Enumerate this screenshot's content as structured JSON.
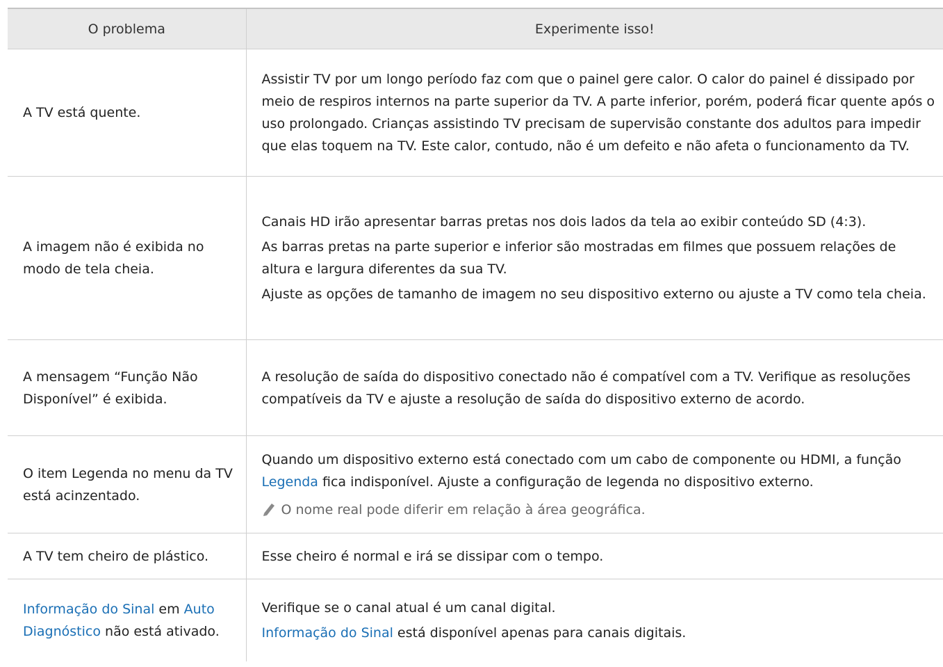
{
  "header": {
    "problem": "O problema",
    "solution": "Experimente isso!"
  },
  "rows": [
    {
      "problem": "A TV está quente.",
      "solution": [
        "Assistir TV por um longo período faz com que o painel gere calor. O calor do painel é dissipado por meio de respiros internos na parte superior da TV. A parte inferior, porém, poderá ficar quente após o uso prolongado. Crianças assistindo TV precisam de supervisão constante dos adultos para impedir que elas toquem na TV. Este calor, contudo, não é um defeito e não afeta o funcionamento da TV."
      ]
    },
    {
      "problem": "A imagem não é exibida no modo de tela cheia.",
      "solution": [
        "Canais HD irão apresentar barras pretas nos dois lados da tela ao exibir conteúdo SD (4:3).",
        "As barras pretas na parte superior e inferior são mostradas em filmes que possuem relações de altura e largura diferentes da sua TV.",
        "Ajuste as opções de tamanho de imagem no seu dispositivo externo ou ajuste a TV como tela cheia."
      ]
    },
    {
      "problem": "A mensagem “Função Não Disponível” é exibida.",
      "solution": [
        "A resolução de saída do dispositivo conectado não é compatível com a TV. Verifique as resoluções compatíveis da TV e ajuste a resolução de saída do dispositivo externo de acordo."
      ]
    },
    {
      "problem": "O item Legenda no menu da TV está acinzentado.",
      "solution_before": "Quando um dispositivo externo está conectado com um cabo de componente ou HDMI, a função ",
      "solution_link": "Legenda",
      "solution_after": " fica indisponível. Ajuste a configuração de legenda no dispositivo externo.",
      "note": "O nome real pode diferir em relação à área geográfica.",
      "note_icon": "pencil-icon"
    },
    {
      "problem": "A TV tem cheiro de plástico.",
      "solution": [
        "Esse cheiro é normal e irá se dissipar com o tempo."
      ]
    },
    {
      "problem_link1": "Informação do Sinal",
      "problem_mid": " em ",
      "problem_link2": "Auto Diagnóstico",
      "problem_after": " não está ativado.",
      "solution_line1": "Verifique se o canal atual é um canal digital.",
      "solution_link": "Informação do Sinal",
      "solution_after": " está disponível apenas para canais digitais."
    }
  ],
  "colors": {
    "link": "#1a6fb5",
    "header_bg": "#e9e9e9",
    "border": "#cfcfcf"
  }
}
